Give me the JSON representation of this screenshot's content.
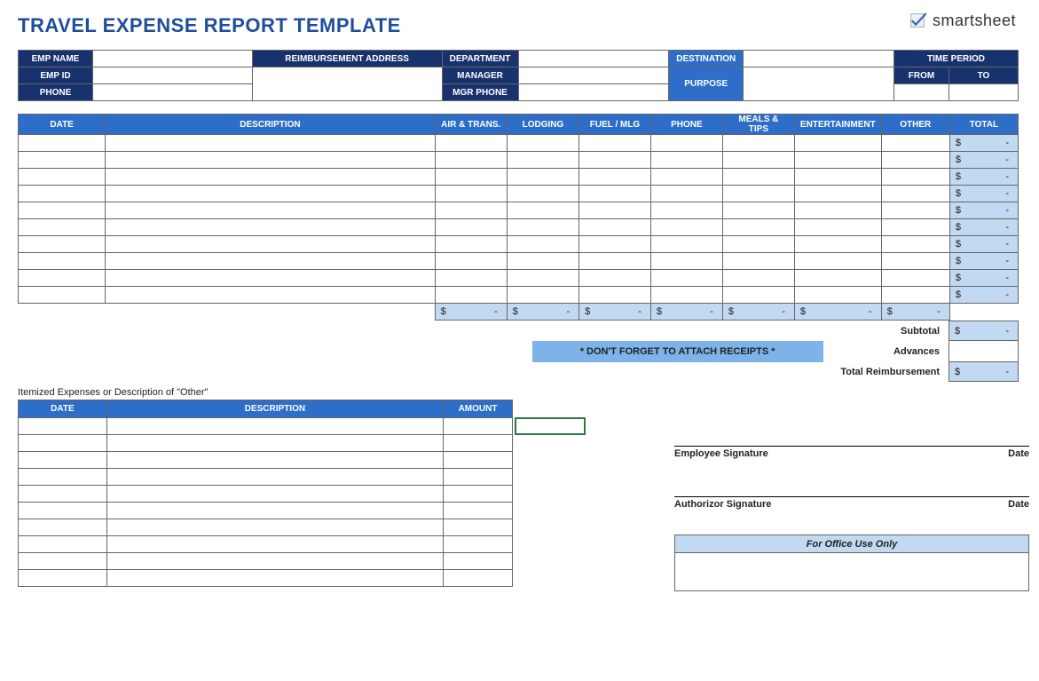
{
  "title": "TRAVEL EXPENSE REPORT TEMPLATE",
  "brand": "smartsheet",
  "header": {
    "emp_name": "EMP NAME",
    "emp_id": "EMP ID",
    "phone": "PHONE",
    "reimb_addr": "REIMBURSEMENT ADDRESS",
    "department": "DEPARTMENT",
    "manager": "MANAGER",
    "mgr_phone": "MGR PHONE",
    "destination": "DESTINATION",
    "purpose": "PURPOSE",
    "time_period": "TIME PERIOD",
    "from": "FROM",
    "to": "TO"
  },
  "columns": {
    "date": "DATE",
    "description": "DESCRIPTION",
    "air_trans": "AIR & TRANS.",
    "lodging": "LODGING",
    "fuel_mlg": "FUEL / MLG",
    "phone": "PHONE",
    "meals_tips": "MEALS & TIPS",
    "entertainment": "ENTERTAINMENT",
    "other": "OTHER",
    "total": "TOTAL"
  },
  "currency_symbol": "$",
  "dash": "-",
  "summary": {
    "receipts_notice": "* DON'T FORGET TO ATTACH RECEIPTS *",
    "subtotal": "Subtotal",
    "advances": "Advances",
    "total_reimb": "Total Reimbursement"
  },
  "itemized": {
    "caption": "Itemized Expenses or Description of \"Other\"",
    "date": "DATE",
    "description": "DESCRIPTION",
    "amount": "AMOUNT"
  },
  "signatures": {
    "employee": "Employee Signature",
    "authorizor": "Authorizor Signature",
    "date_lbl": "Date"
  },
  "office_use": "For Office Use Only"
}
